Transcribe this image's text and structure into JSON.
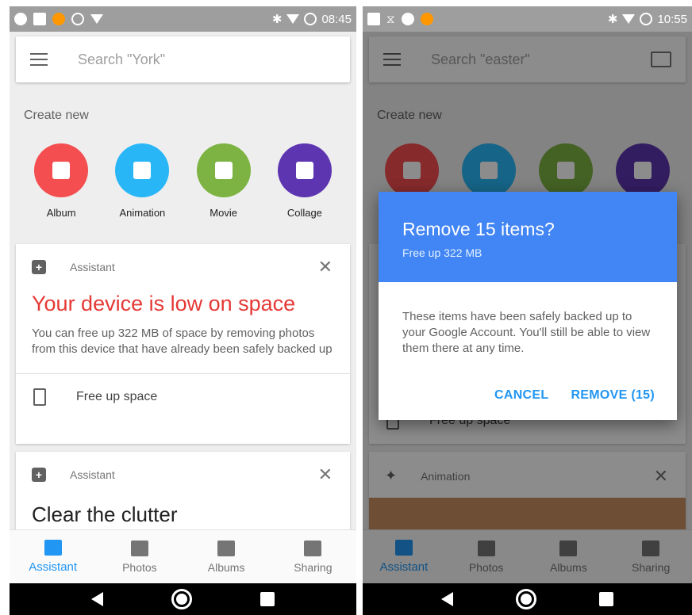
{
  "left": {
    "status": {
      "time": "08:45"
    },
    "search": {
      "placeholder": "Search \"York\""
    },
    "create": {
      "label": "Create new",
      "items": [
        {
          "label": "Album",
          "color": "#f44e50",
          "icon": "album-icon"
        },
        {
          "label": "Animation",
          "color": "#29b6f6",
          "icon": "animation-icon"
        },
        {
          "label": "Movie",
          "color": "#7cb342",
          "icon": "movie-icon"
        },
        {
          "label": "Collage",
          "color": "#5e35b1",
          "icon": "collage-icon"
        }
      ]
    },
    "card1": {
      "label": "Assistant",
      "title": "Your device is low on space",
      "body": "You can free up 322 MB of space by removing photos from this device that have already been safely backed up",
      "action": "Free up space"
    },
    "card2": {
      "label": "Assistant",
      "title": "Clear the clutter"
    },
    "nav": {
      "items": [
        {
          "label": "Assistant",
          "active": true
        },
        {
          "label": "Photos",
          "active": false
        },
        {
          "label": "Albums",
          "active": false
        },
        {
          "label": "Sharing",
          "active": false
        }
      ]
    }
  },
  "right": {
    "status": {
      "time": "10:55"
    },
    "search": {
      "placeholder": "Search \"easter\""
    },
    "create": {
      "label": "Create new"
    },
    "card1": {
      "action": "Free up space"
    },
    "card2": {
      "label": "Animation"
    },
    "dialog": {
      "title": "Remove 15 items?",
      "subtitle": "Free up 322 MB",
      "body": "These items have been safely backed up to your Google Account. You'll still be able to view them there at any time.",
      "cancel": "CANCEL",
      "confirm": "REMOVE (15)"
    },
    "nav": {
      "items": [
        {
          "label": "Assistant",
          "active": true
        },
        {
          "label": "Photos",
          "active": false
        },
        {
          "label": "Albums",
          "active": false
        },
        {
          "label": "Sharing",
          "active": false
        }
      ]
    }
  }
}
